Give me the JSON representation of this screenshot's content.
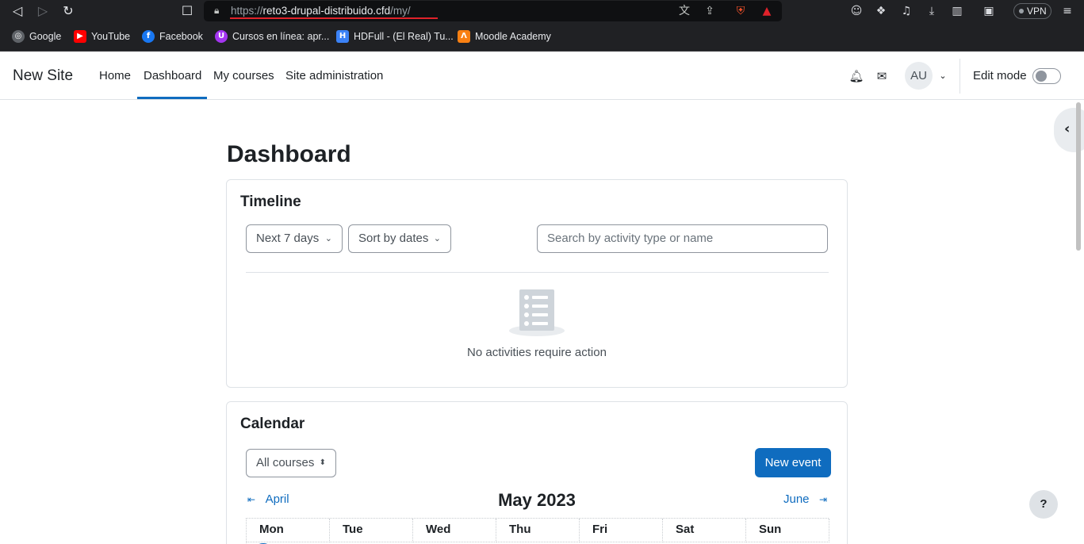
{
  "browser": {
    "url_scheme": "https://",
    "url_host": "reto3-drupal-distribuido.cfd",
    "url_path": "/my/",
    "vpn_label": "VPN",
    "bookmarks": [
      {
        "label": "Google",
        "icon": "globe-icon",
        "color": "#5f6368"
      },
      {
        "label": "YouTube",
        "icon": "youtube-icon",
        "color": "#ff0000"
      },
      {
        "label": "Facebook",
        "icon": "facebook-icon",
        "color": "#1877f2"
      },
      {
        "label": "Cursos en línea: apr...",
        "icon": "udemy-icon",
        "color": "#a435f0"
      },
      {
        "label": "HDFull - (El Real) Tu...",
        "icon": "hdfull-icon",
        "color": "#3b82f6"
      },
      {
        "label": "Moodle Academy",
        "icon": "moodle-icon",
        "color": "#f98012"
      }
    ]
  },
  "navbar": {
    "brand": "New Site",
    "links": [
      "Home",
      "Dashboard",
      "My courses",
      "Site administration"
    ],
    "active_link": "Dashboard",
    "user_initials": "AU",
    "edit_mode_label": "Edit mode",
    "edit_mode_on": false
  },
  "page": {
    "title": "Dashboard"
  },
  "timeline": {
    "title": "Timeline",
    "filter_label": "Next 7 days",
    "sort_label": "Sort by dates",
    "search_placeholder": "Search by activity type or name",
    "empty_message": "No activities require action"
  },
  "calendar": {
    "title": "Calendar",
    "course_filter": "All courses",
    "new_event_label": "New event",
    "prev_month": "April",
    "current_month": "May 2023",
    "next_month": "June",
    "weekdays": [
      "Mon",
      "Tue",
      "Wed",
      "Thu",
      "Fri",
      "Sat",
      "Sun"
    ]
  },
  "help_label": "?",
  "colors": {
    "primary": "#0f6cbf",
    "chrome_bg": "#202124"
  }
}
